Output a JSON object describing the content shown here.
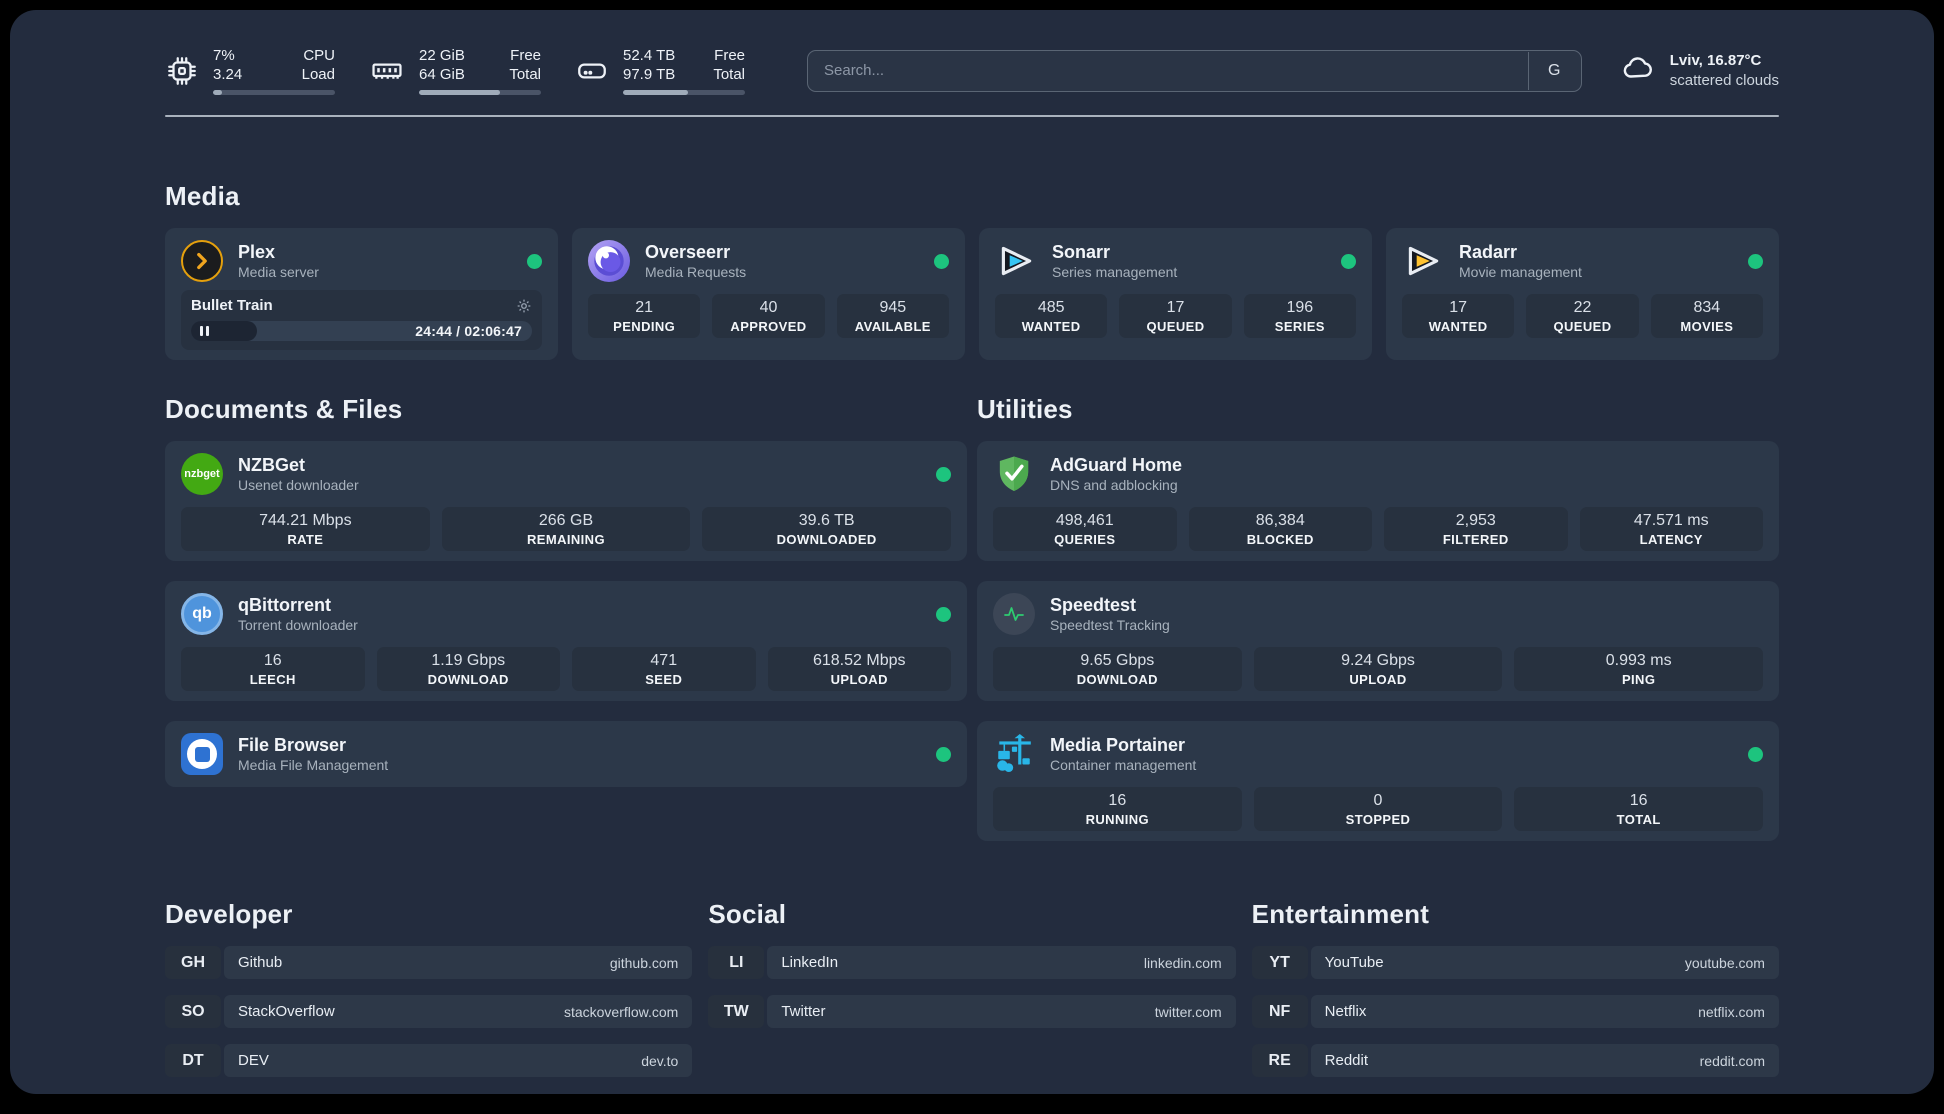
{
  "header": {
    "stats": [
      {
        "icon": "cpu-icon",
        "line1_left": "7%",
        "line2_left": "3.24",
        "line1_right": "CPU",
        "line2_right": "Load",
        "progress": 7
      },
      {
        "icon": "memory-icon",
        "line1_left": "22 GiB",
        "line2_left": "64 GiB",
        "line1_right": "Free",
        "line2_right": "Total",
        "progress": 66
      },
      {
        "icon": "disk-icon",
        "line1_left": "52.4 TB",
        "line2_left": "97.9 TB",
        "line1_right": "Free",
        "line2_right": "Total",
        "progress": 53
      }
    ],
    "search": {
      "placeholder": "Search...",
      "engine": "G"
    },
    "weather": {
      "location": "Lviv, 16.87°C",
      "condition": "scattered clouds"
    }
  },
  "sections": {
    "media": {
      "title": "Media",
      "cards": [
        {
          "name": "Plex",
          "subtitle": "Media server",
          "online": true,
          "player": {
            "track": "Bullet Train",
            "time": "24:44 / 02:06:47",
            "progress": 19.5
          }
        },
        {
          "name": "Overseerr",
          "subtitle": "Media Requests",
          "online": true,
          "stats": [
            {
              "value": "21",
              "label": "PENDING"
            },
            {
              "value": "40",
              "label": "APPROVED"
            },
            {
              "value": "945",
              "label": "AVAILABLE"
            }
          ]
        },
        {
          "name": "Sonarr",
          "subtitle": "Series management",
          "online": true,
          "stats": [
            {
              "value": "485",
              "label": "WANTED"
            },
            {
              "value": "17",
              "label": "QUEUED"
            },
            {
              "value": "196",
              "label": "SERIES"
            }
          ]
        },
        {
          "name": "Radarr",
          "subtitle": "Movie management",
          "online": true,
          "stats": [
            {
              "value": "17",
              "label": "WANTED"
            },
            {
              "value": "22",
              "label": "QUEUED"
            },
            {
              "value": "834",
              "label": "MOVIES"
            }
          ]
        }
      ]
    },
    "documents": {
      "title": "Documents & Files",
      "cards": [
        {
          "name": "NZBGet",
          "subtitle": "Usenet downloader",
          "online": true,
          "icon_text": "nzbget",
          "stats": [
            {
              "value": "744.21 Mbps",
              "label": "RATE"
            },
            {
              "value": "266 GB",
              "label": "REMAINING"
            },
            {
              "value": "39.6 TB",
              "label": "DOWNLOADED"
            }
          ]
        },
        {
          "name": "qBittorrent",
          "subtitle": "Torrent downloader",
          "online": true,
          "icon_text": "qb",
          "stats": [
            {
              "value": "16",
              "label": "LEECH"
            },
            {
              "value": "1.19 Gbps",
              "label": "DOWNLOAD"
            },
            {
              "value": "471",
              "label": "SEED"
            },
            {
              "value": "618.52 Mbps",
              "label": "UPLOAD"
            }
          ]
        },
        {
          "name": "File Browser",
          "subtitle": "Media File Management",
          "online": true
        }
      ]
    },
    "utilities": {
      "title": "Utilities",
      "cards": [
        {
          "name": "AdGuard Home",
          "subtitle": "DNS and adblocking",
          "online": false,
          "stats": [
            {
              "value": "498,461",
              "label": "QUERIES"
            },
            {
              "value": "86,384",
              "label": "BLOCKED"
            },
            {
              "value": "2,953",
              "label": "FILTERED"
            },
            {
              "value": "47.571 ms",
              "label": "LATENCY"
            }
          ]
        },
        {
          "name": "Speedtest",
          "subtitle": "Speedtest Tracking",
          "online": false,
          "stats": [
            {
              "value": "9.65 Gbps",
              "label": "DOWNLOAD"
            },
            {
              "value": "9.24 Gbps",
              "label": "UPLOAD"
            },
            {
              "value": "0.993 ms",
              "label": "PING"
            }
          ]
        },
        {
          "name": "Media Portainer",
          "subtitle": "Container management",
          "online": true,
          "stats": [
            {
              "value": "16",
              "label": "RUNNING"
            },
            {
              "value": "0",
              "label": "STOPPED"
            },
            {
              "value": "16",
              "label": "TOTAL"
            }
          ]
        }
      ]
    },
    "developer": {
      "title": "Developer",
      "links": [
        {
          "abbr": "GH",
          "name": "Github",
          "url": "github.com"
        },
        {
          "abbr": "SO",
          "name": "StackOverflow",
          "url": "stackoverflow.com"
        },
        {
          "abbr": "DT",
          "name": "DEV",
          "url": "dev.to"
        }
      ]
    },
    "social": {
      "title": "Social",
      "links": [
        {
          "abbr": "LI",
          "name": "LinkedIn",
          "url": "linkedin.com"
        },
        {
          "abbr": "TW",
          "name": "Twitter",
          "url": "twitter.com"
        }
      ]
    },
    "entertainment": {
      "title": "Entertainment",
      "links": [
        {
          "abbr": "YT",
          "name": "YouTube",
          "url": "youtube.com"
        },
        {
          "abbr": "NF",
          "name": "Netflix",
          "url": "netflix.com"
        },
        {
          "abbr": "RE",
          "name": "Reddit",
          "url": "reddit.com"
        }
      ]
    }
  },
  "colors": {
    "online_dot": "#1dc47e",
    "plex_amber": "#e5a00d",
    "sonarr_blue": "#35c5f4",
    "radarr_yellow": "#ffc230",
    "adguard_green": "#5fb760",
    "portainer_blue": "#29b6e8",
    "nzbget_green": "#43a913",
    "qbittorrent_blue": "#4f94dc"
  }
}
